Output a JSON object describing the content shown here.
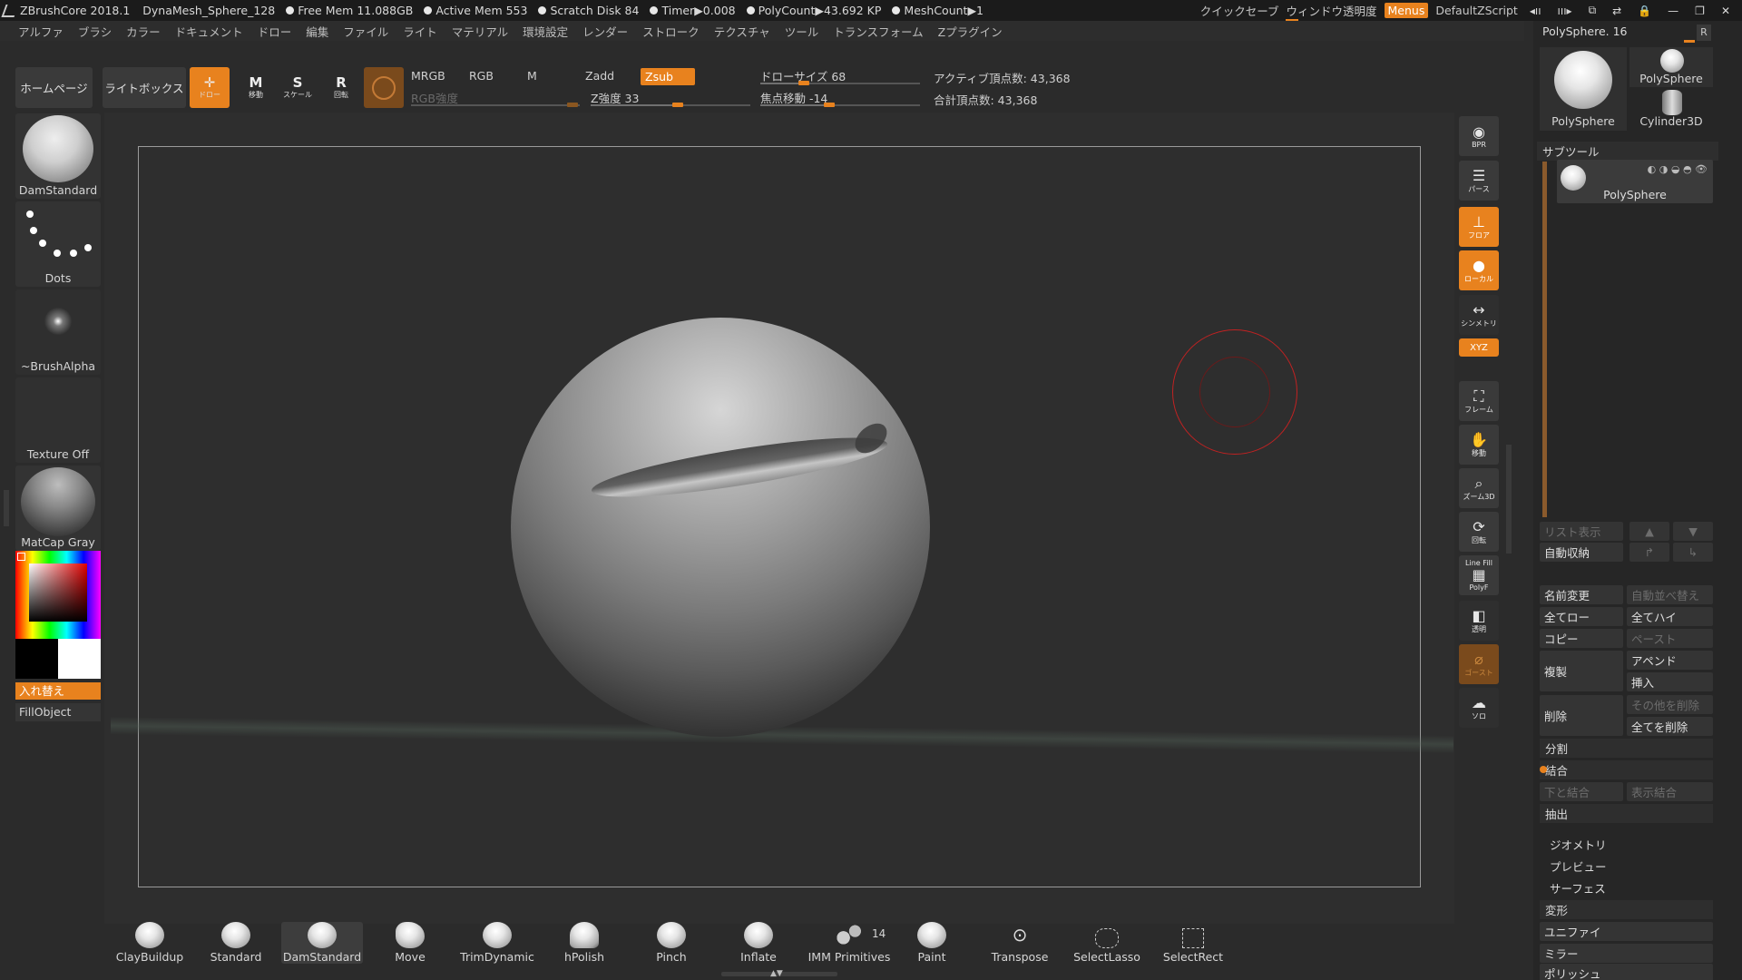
{
  "titlebar": {
    "app": "ZBrushCore 2018.1",
    "document": "DynaMesh_Sphere_128",
    "free_mem": "Free Mem 11.088GB",
    "active_mem": "Active Mem 553",
    "scratch_disk": "Scratch Disk 84",
    "timer": "Timer▶0.008",
    "polycount": "PolyCount▶43.692 KP",
    "meshcount": "MeshCount▶1",
    "quicksave": "クイックセーブ",
    "window_transparency": "ウィンドウ透明度",
    "menus": "Menus",
    "script": "DefaultZScript"
  },
  "menubar": [
    "アルファ",
    "ブラシ",
    "カラー",
    "ドキュメント",
    "ドロー",
    "編集",
    "ファイル",
    "ライト",
    "マテリアル",
    "環境設定",
    "レンダー",
    "ストローク",
    "テクスチャ",
    "ツール",
    "トランスフォーム",
    "Zプラグイン"
  ],
  "shelf": {
    "homepage": "ホームページ",
    "lightbox": "ライトボックス",
    "draw": "ドロー",
    "move": "移動",
    "scale": "スケール",
    "rotate": "回転",
    "mrgb": "MRGB",
    "rgb": "RGB",
    "m": "M",
    "zadd": "Zadd",
    "zsub": "Zsub",
    "rgb_intensity": "RGB強度",
    "z_intensity": "Z強度 33",
    "draw_size": "ドローサイズ 68",
    "focal_shift": "焦点移動 -14",
    "active_points": "アクティブ頂点数: 43,368",
    "total_points": "合計頂点数: 43,368"
  },
  "left_panel": {
    "brush": "DamStandard",
    "stroke": "Dots",
    "alpha": "~BrushAlpha",
    "texture": "Texture Off",
    "material": "MatCap Gray",
    "switch": "入れ替え",
    "fill": "FillObject"
  },
  "right_toolbar": [
    "BPR",
    "パース",
    "フロア",
    "ローカル",
    "シンメトリ",
    "XYZ",
    "フレーム",
    "移動",
    "ズーム3D",
    "回転",
    "Line Fill",
    "PolyF",
    "透明",
    "ゴースト",
    "ソロ"
  ],
  "right_panel": {
    "tool_name": "PolySphere. 16",
    "r": "R",
    "thumb_main": "PolySphere",
    "thumb_small_1": "PolySphere",
    "thumb_small_2": "Cylinder3D",
    "subtool_header": "サブツール",
    "subtool_item": "PolySphere",
    "list_view": "リスト表示",
    "auto_collapse": "自動収納",
    "rename": "名前変更",
    "auto_reorder": "自動並べ替え",
    "all_low": "全てロー",
    "all_high": "全てハイ",
    "copy": "コピー",
    "paste": "ペースト",
    "duplicate": "複製",
    "append": "アペンド",
    "insert": "挿入",
    "delete": "削除",
    "delete_other": "その他を削除",
    "delete_all": "全てを削除",
    "split": "分割",
    "merge": "結合",
    "merge_down": "下と結合",
    "merge_visible": "表示結合",
    "extract": "抽出",
    "geometry": "ジオメトリ",
    "preview": "プレビュー",
    "surface": "サーフェス",
    "deformation": "変形",
    "unify": "ユニファイ",
    "mirror": "ミラー",
    "polish": "ポリッシュ"
  },
  "bottom_brushes": [
    "ClayBuildup",
    "Standard",
    "DamStandard",
    "Move",
    "TrimDynamic",
    "hPolish",
    "Pinch",
    "Inflate",
    "IMM Primitives",
    "Paint",
    "Transpose",
    "SelectLasso",
    "SelectRect"
  ],
  "imm_count": "14",
  "colors": {
    "accent": "#e8821e",
    "cursor": "#c02222"
  }
}
